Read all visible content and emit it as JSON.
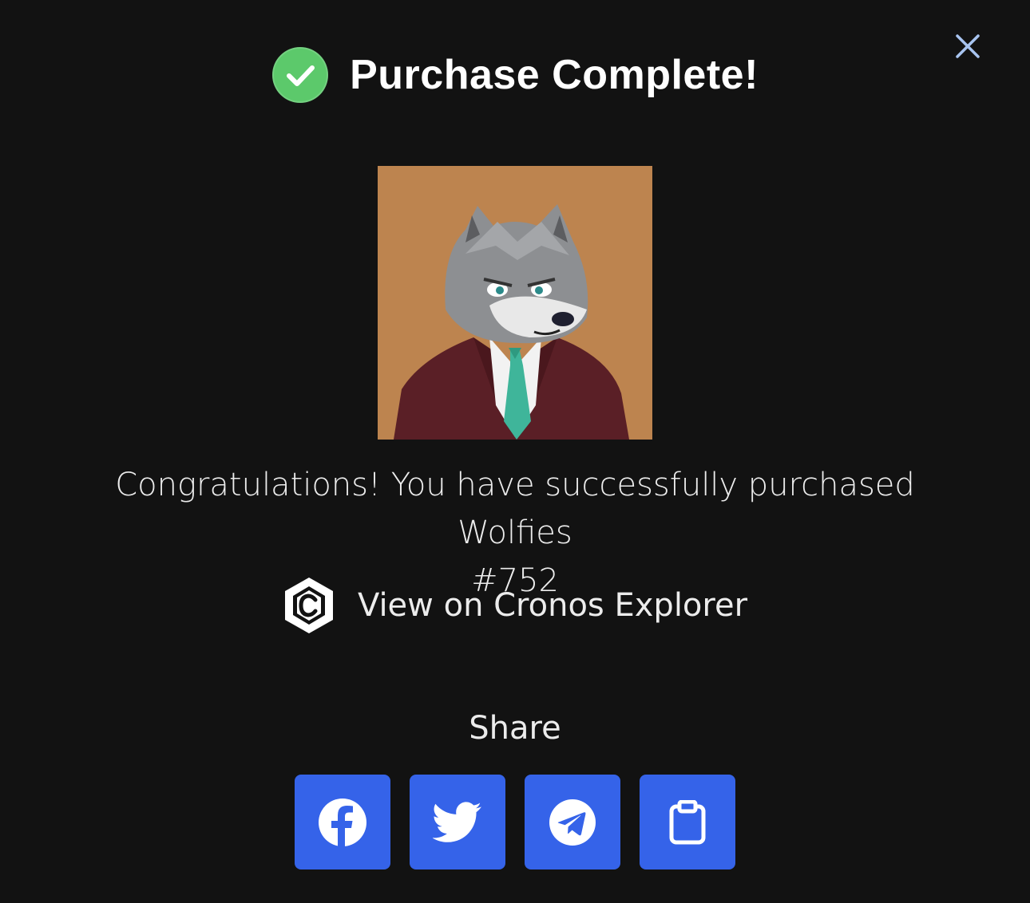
{
  "modal": {
    "title": "Purchase Complete!",
    "message_line1": "Congratulations! You have successfully purchased Wolfies",
    "message_line2": "#752",
    "explorer_link": "View on Cronos Explorer",
    "share_label": "Share"
  },
  "share_buttons": [
    {
      "icon": "facebook-icon"
    },
    {
      "icon": "twitter-icon"
    },
    {
      "icon": "telegram-icon"
    },
    {
      "icon": "clipboard-icon"
    }
  ],
  "colors": {
    "background": "#121212",
    "success_green": "#5cc96b",
    "share_button": "#3563e9",
    "close_icon": "#a8c4f0",
    "nft_background": "#bd844f"
  }
}
